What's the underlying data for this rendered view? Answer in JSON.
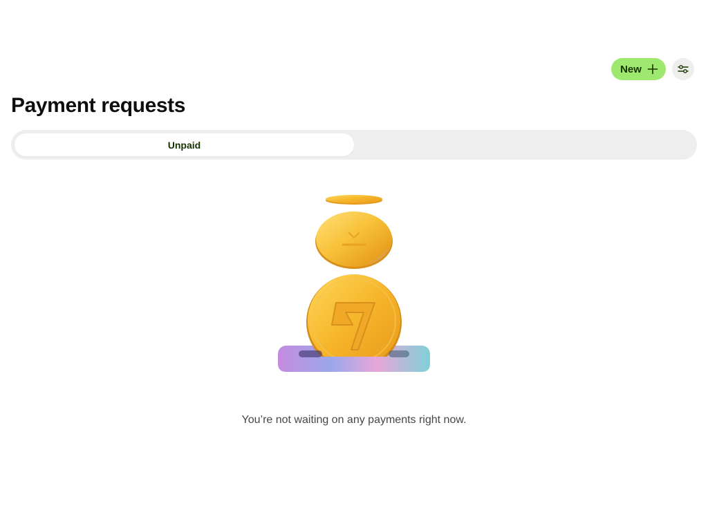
{
  "header": {
    "new_button_label": "New",
    "new_button_icon": "plus-icon",
    "filter_button_icon": "filter-sliders-icon"
  },
  "page": {
    "title": "Payment requests"
  },
  "tabs": [
    {
      "label": "Unpaid",
      "active": true
    },
    {
      "label": "",
      "active": false
    }
  ],
  "empty_state": {
    "illustration": "coins-stack-illustration",
    "message": "You’re not waiting on any payments right now."
  },
  "colors": {
    "accent": "#9fe870",
    "accent_text": "#163300",
    "tab_track": "#eeeeee",
    "coin_gold": "#f5b82e"
  }
}
